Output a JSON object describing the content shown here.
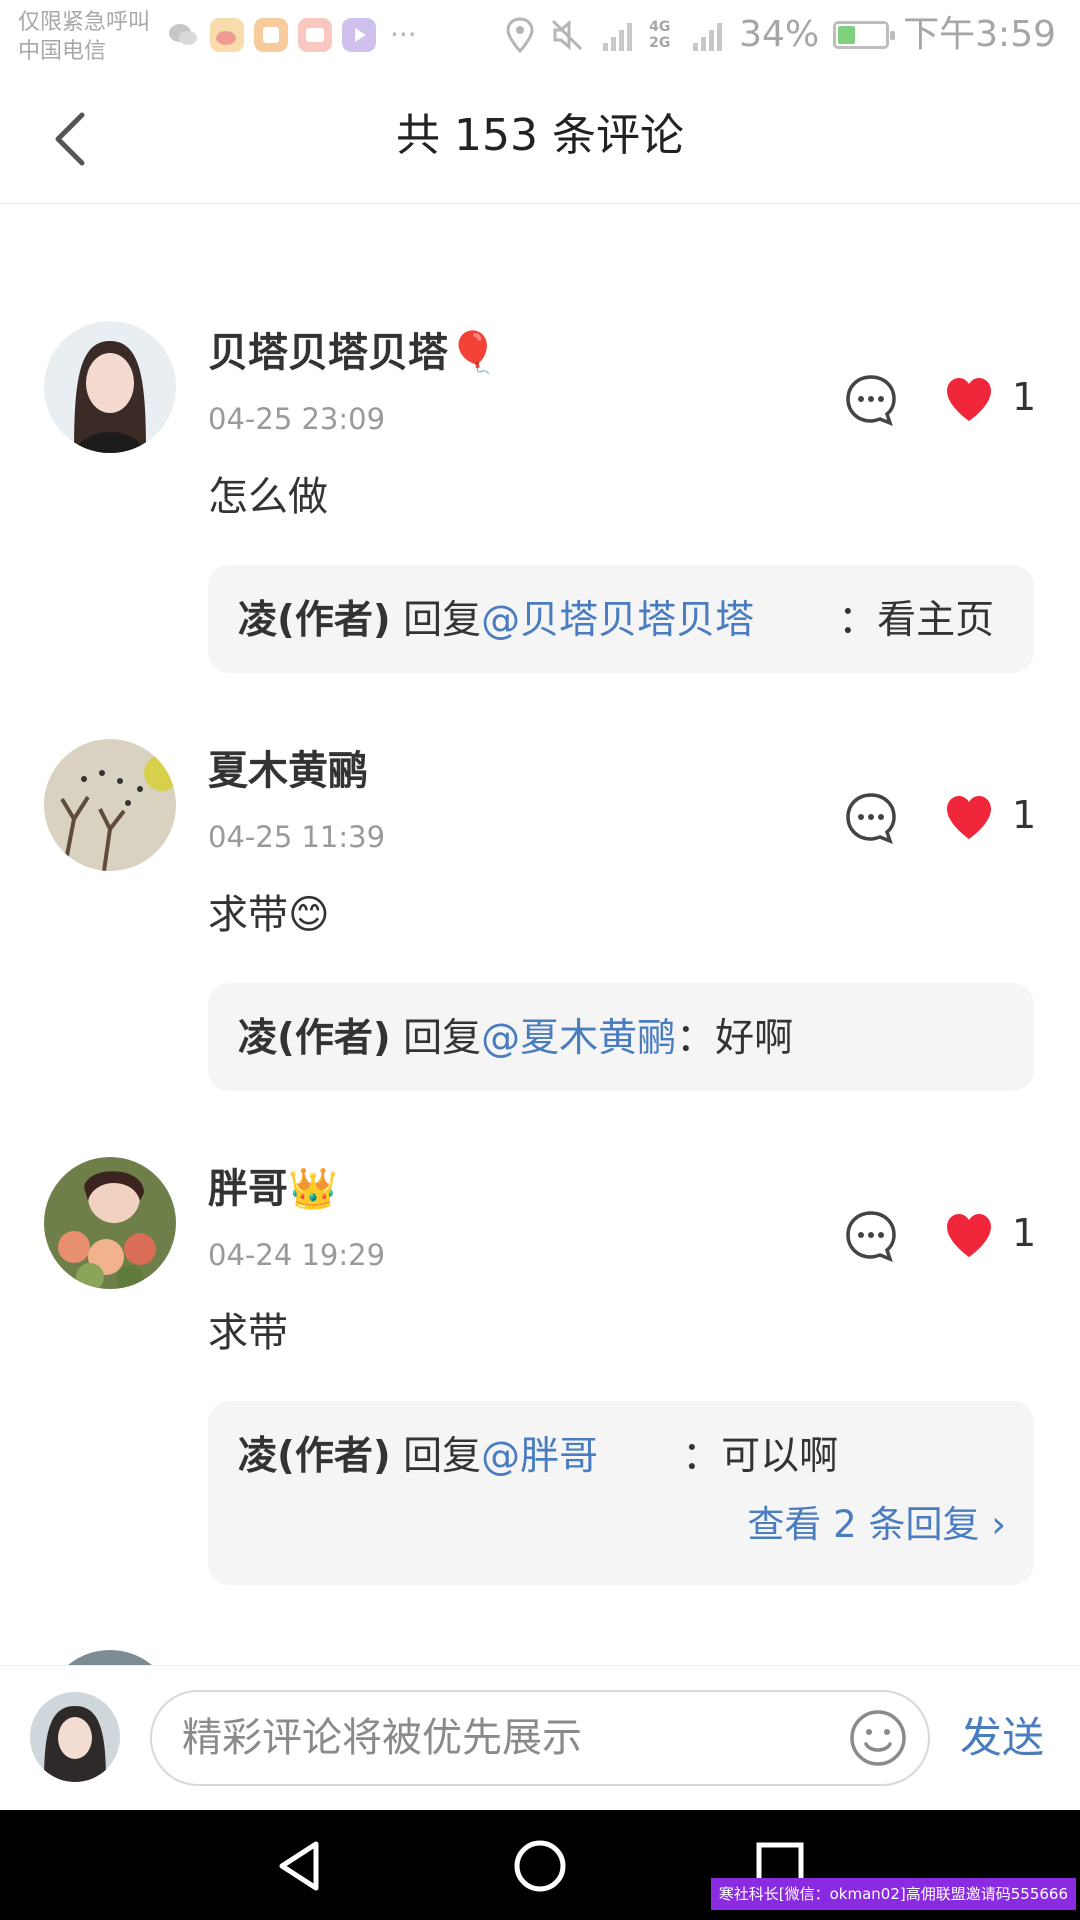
{
  "status_bar": {
    "carrier_line1": "仅限紧急呼叫",
    "carrier_line2": "中国电信",
    "more_icon": "···",
    "network": "4G 2G",
    "battery": "34%",
    "battery_level": 0.34,
    "time": "下午3:59"
  },
  "header": {
    "title": "共 153 条评论",
    "back_icon": "chevron-left-icon"
  },
  "comments": [
    {
      "username": "贝塔贝塔贝塔",
      "badge": "🎈",
      "time": "04-25 23:09",
      "likes": "1",
      "content": "怎么做",
      "content_emoji": "",
      "reply": {
        "author": "凌(作者)",
        "verb": "回复",
        "target": "@贝塔贝塔贝塔",
        "colon": "：",
        "text": "看主页"
      }
    },
    {
      "username": "夏木黄鹂",
      "badge": "",
      "time": "04-25 11:39",
      "likes": "1",
      "content": "求带",
      "content_emoji": "😊",
      "reply": {
        "author": "凌(作者)",
        "verb": "回复",
        "target": "@夏木黄鹂",
        "colon": "：",
        "text": "好啊"
      }
    },
    {
      "username": "胖哥",
      "badge": "👑",
      "time": "04-24 19:29",
      "likes": "1",
      "content": "求带",
      "content_emoji": "",
      "reply": {
        "author": "凌(作者)",
        "verb": "回复",
        "target": "@胖哥",
        "colon": "：",
        "text": "可以啊"
      },
      "view_replies": "查看 2 条回复 ›"
    }
  ],
  "input_bar": {
    "placeholder": "精彩评论将被优先展示",
    "send_label": "发送"
  },
  "watermark": "寒社科长[微信：okman02]高佣联盟邀请码555666",
  "colors": {
    "link": "#4a7cc0",
    "like": "#f0273a",
    "reply_bg": "#f5f5f5",
    "nav_bg": "#000000"
  }
}
